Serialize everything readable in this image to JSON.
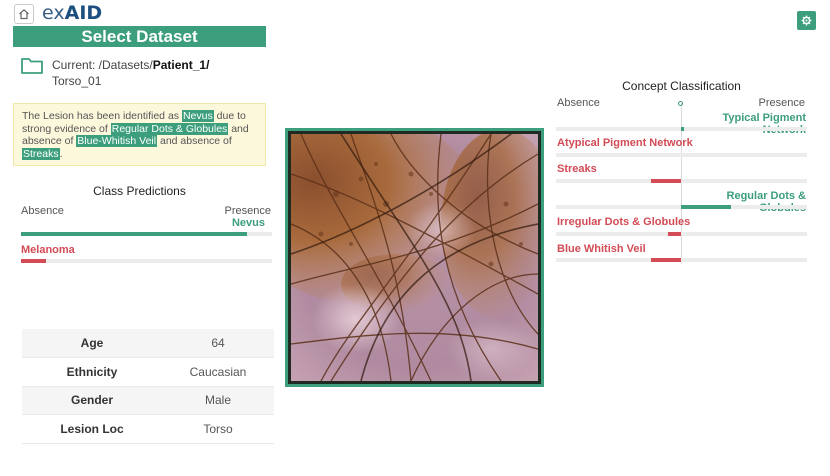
{
  "app": {
    "brand_ex": "ex",
    "brand_aid": "AID"
  },
  "colors": {
    "accent": "#3c9e7c",
    "negative": "#d24b55",
    "explanation_bg": "#fcf8dc",
    "brand": "#1c4e80"
  },
  "icons": {
    "home": "home-icon",
    "settings": "gear-icon",
    "folder": "folder-icon"
  },
  "dataset": {
    "button_label": "Select Dataset",
    "current_label": "Current: /Datasets/",
    "selected": "Patient_1/",
    "file": "Torso_01"
  },
  "explanation": {
    "t1": "The Lesion has been identified as ",
    "diagnosis": "Nevus",
    "t2": " due to strong evidence of ",
    "evidence": "Regular Dots & Globules",
    "t3": " and absence of ",
    "absent1": "Blue-Whitish Veil",
    "t4": " and absence of ",
    "absent2": "Streaks",
    "t5": "."
  },
  "class_predictions": {
    "title": "Class Predictions",
    "absence": "Absence",
    "presence": "Presence",
    "items": [
      {
        "name": "Nevus",
        "side": "presence",
        "level": 0.9
      },
      {
        "name": "Melanoma",
        "side": "absence",
        "level": 0.1
      }
    ]
  },
  "patient": [
    {
      "key": "Age",
      "value": "64"
    },
    {
      "key": "Ethnicity",
      "value": "Caucasian"
    },
    {
      "key": "Gender",
      "value": "Male"
    },
    {
      "key": "Lesion Loc",
      "value": "Torso"
    }
  ],
  "concepts": {
    "title": "Concept Classification",
    "absence": "Absence",
    "presence": "Presence",
    "items": [
      {
        "name": "Typical Pigment Network",
        "side": "presence",
        "level": 0.02
      },
      {
        "name": "Atypical Pigment Network",
        "side": "absence",
        "level": 0.0
      },
      {
        "name": "Streaks",
        "side": "absence",
        "level": 0.24
      },
      {
        "name": "Regular Dots & Globules",
        "side": "presence",
        "level": 0.4
      },
      {
        "name": "Irregular Dots & Globules",
        "side": "absence",
        "level": 0.1
      },
      {
        "name": "Blue Whitish Veil",
        "side": "absence",
        "level": 0.24
      }
    ]
  }
}
